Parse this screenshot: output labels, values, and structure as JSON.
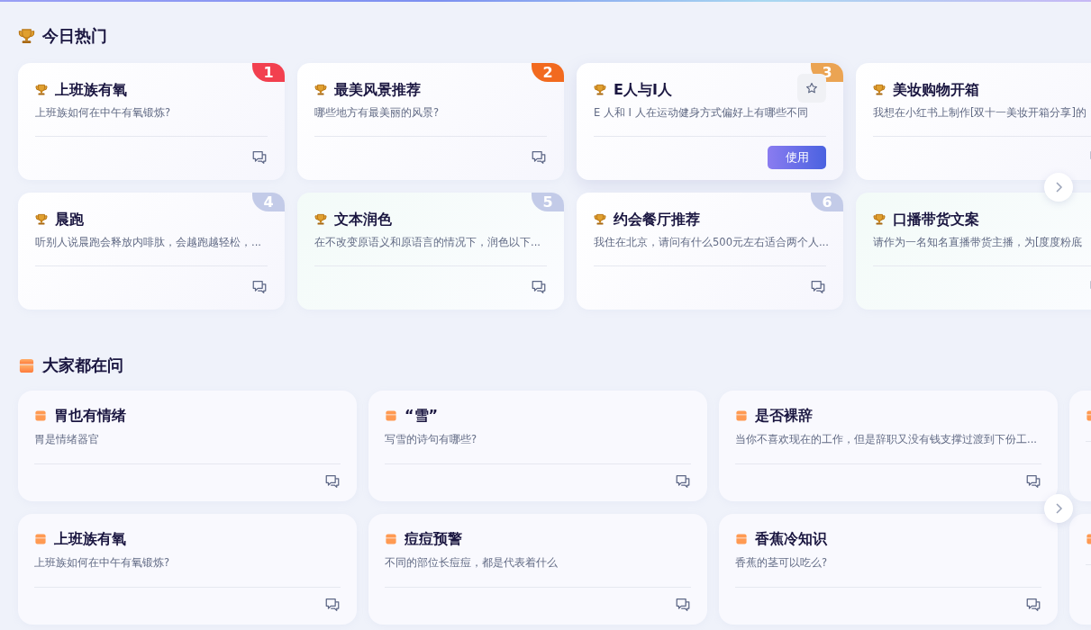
{
  "sections": [
    {
      "kind": "hot",
      "title": "今日热门",
      "rows": [
        [
          {
            "title": "上班族有氧",
            "desc": "上班族如何在中午有氧锻炼?",
            "rank": "1",
            "color": "#f2404f",
            "hovered": false
          },
          {
            "title": "最美风景推荐",
            "desc": "哪些地方有最美丽的风景?",
            "rank": "2",
            "color": "#f26a1f",
            "hovered": false
          },
          {
            "title": "E人与I人",
            "desc": "E 人和 I 人在运动健身方式偏好上有哪些不同",
            "rank": "3",
            "color": "#eba453",
            "hovered": true,
            "action": "使用"
          },
          {
            "title": "美妆购物开箱",
            "desc": "我想在小红书上制作[双十一美妆开箱分享]的",
            "hovered": false
          }
        ],
        [
          {
            "title": "晨跑",
            "desc": "听别人说晨跑会释放内啡肽，会越跑越轻松，...",
            "rank": "4",
            "color": "#c3cbe8",
            "hovered": false
          },
          {
            "title": "文本润色",
            "desc": "在不改变原语义和原语言的情况下，润色以下...",
            "rank": "5",
            "color": "#c3cbe8",
            "hovered": false
          },
          {
            "title": "约会餐厅推荐",
            "desc": "我住在北京，请问有什么500元左右适合两个人...",
            "rank": "6",
            "color": "#c3cbe8",
            "hovered": false
          },
          {
            "title": "口播带货文案",
            "desc": "请作为一名知名直播带货主播，为[度度粉底",
            "hovered": false
          }
        ]
      ]
    },
    {
      "kind": "ask",
      "title": "大家都在问",
      "rows": [
        [
          {
            "title": "胃也有情绪",
            "desc": "胃是情绪器官",
            "hovered": false
          },
          {
            "title": "“雪”",
            "desc": "写雪的诗句有哪些?",
            "hovered": false
          },
          {
            "title": "是否裸辞",
            "desc": "当你不喜欢现在的工作，但是辞职又没有钱支撑过渡到下份工...",
            "hovered": false
          },
          {
            "kind": "partial"
          }
        ],
        [
          {
            "title": "上班族有氧",
            "desc": "上班族如何在中午有氧锻炼?",
            "hovered": false
          },
          {
            "title": "痘痘预警",
            "desc": "不同的部位长痘痘，都是代表着什么",
            "hovered": false
          },
          {
            "title": "香蕉冷知识",
            "desc": "香蕉的茎可以吃么?",
            "hovered": false
          },
          {
            "kind": "partial"
          }
        ]
      ]
    }
  ]
}
